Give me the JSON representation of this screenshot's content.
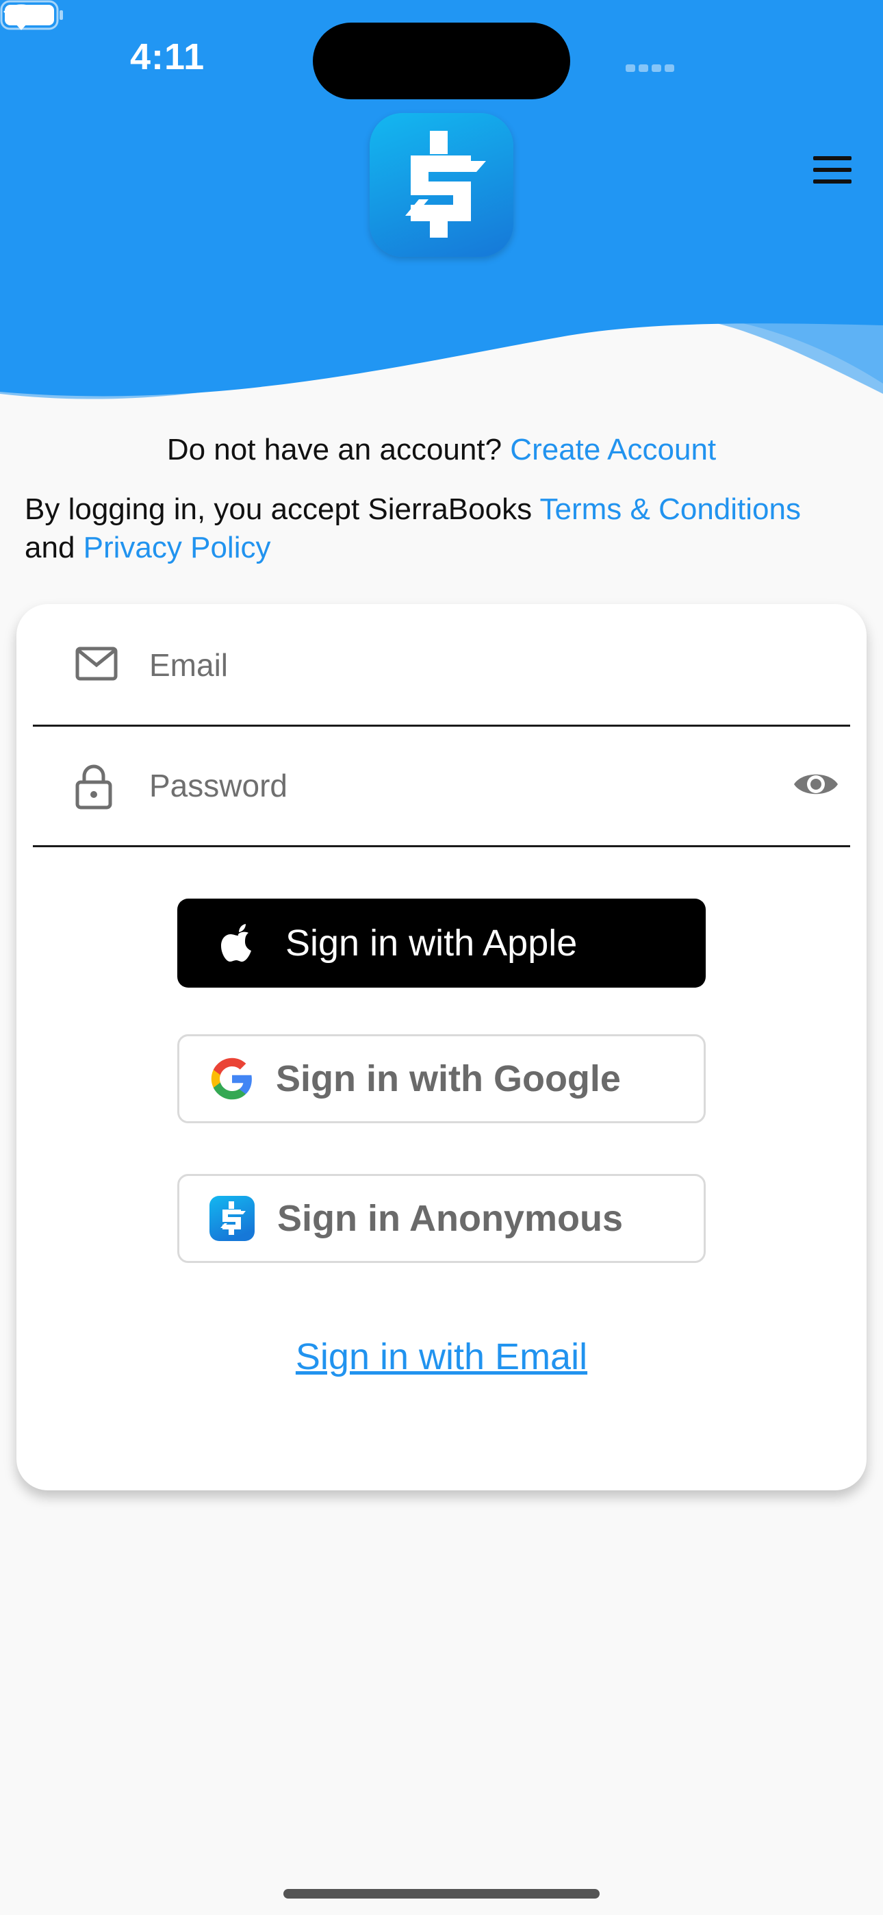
{
  "status_bar": {
    "time": "4:11"
  },
  "colors": {
    "header_blue": "#2196f3",
    "header_wave_light": "#a8d4f8",
    "link_blue": "#2193ef",
    "apple_button": "#000000"
  },
  "icons": {
    "app_logo": "dollar-sign-logo-icon",
    "menu": "hamburger-menu-icon",
    "email": "mail-icon",
    "password": "lock-icon",
    "password_visibility": "eye-icon",
    "apple": "apple-logo-icon",
    "google": "google-logo-icon",
    "anonymous": "app-logo-small-icon"
  },
  "account_prompt": {
    "text": "Do not have an account? ",
    "link": "Create Account"
  },
  "terms": {
    "prefix": "By logging in, you accept SierraBooks ",
    "terms_link": "Terms & Conditions",
    "middle": "and ",
    "privacy_link": "Privacy Policy"
  },
  "form": {
    "email_placeholder": "Email",
    "email_value": "",
    "password_placeholder": "Password",
    "password_value": ""
  },
  "buttons": {
    "apple": "Sign in with Apple",
    "google": "Sign in with Google",
    "anonymous": "Sign in Anonymous",
    "email": "Sign in with Email"
  }
}
